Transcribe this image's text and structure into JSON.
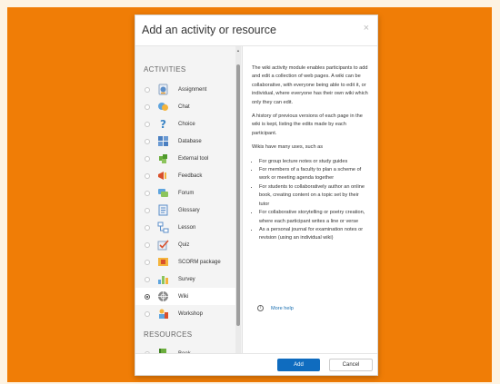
{
  "modal": {
    "title": "Add an activity or resource",
    "close_glyph": "×",
    "sections": {
      "activities": "ACTIVITIES",
      "resources": "RESOURCES"
    },
    "activities": [
      {
        "label": "Assignment",
        "icon": "assignment-icon",
        "selected": false
      },
      {
        "label": "Chat",
        "icon": "chat-icon",
        "selected": false
      },
      {
        "label": "Choice",
        "icon": "choice-icon",
        "selected": false
      },
      {
        "label": "Database",
        "icon": "database-icon",
        "selected": false
      },
      {
        "label": "External tool",
        "icon": "external-tool-icon",
        "selected": false
      },
      {
        "label": "Feedback",
        "icon": "feedback-icon",
        "selected": false
      },
      {
        "label": "Forum",
        "icon": "forum-icon",
        "selected": false
      },
      {
        "label": "Glossary",
        "icon": "glossary-icon",
        "selected": false
      },
      {
        "label": "Lesson",
        "icon": "lesson-icon",
        "selected": false
      },
      {
        "label": "Quiz",
        "icon": "quiz-icon",
        "selected": false
      },
      {
        "label": "SCORM package",
        "icon": "scorm-icon",
        "selected": false
      },
      {
        "label": "Survey",
        "icon": "survey-icon",
        "selected": false
      },
      {
        "label": "Wiki",
        "icon": "wiki-icon",
        "selected": true
      },
      {
        "label": "Workshop",
        "icon": "workshop-icon",
        "selected": false
      }
    ],
    "resources": [
      {
        "label": "Book",
        "icon": "book-icon",
        "selected": false
      }
    ],
    "description": {
      "p1": "The wiki activity module enables participants to add and edit a collection of web pages. A wiki can be collaborative, with everyone being able to edit it, or individual, where everyone has their own wiki which only they can edit.",
      "p2": "A history of previous versions of each page in the wiki is kept, listing the edits made by each participant.",
      "p3": "Wikis have many uses, such as",
      "bullets": [
        "For group lecture notes or study guides",
        "For members of a faculty to plan a scheme of work or meeting agenda together",
        "For students to collaboratively author an online book, creating content on a topic set by their tutor",
        "For collaborative storytelling or poetry creation, where each participant writes a line or verse",
        "As a personal journal for examination notes or revision (using an individual wiki)"
      ],
      "more_help": "More help",
      "info_glyph": "i"
    },
    "buttons": {
      "add": "Add",
      "cancel": "Cancel"
    }
  },
  "colors": {
    "backdrop": "#f07d06",
    "primary_button": "#0f6cbf",
    "link": "#1a6fb0"
  }
}
